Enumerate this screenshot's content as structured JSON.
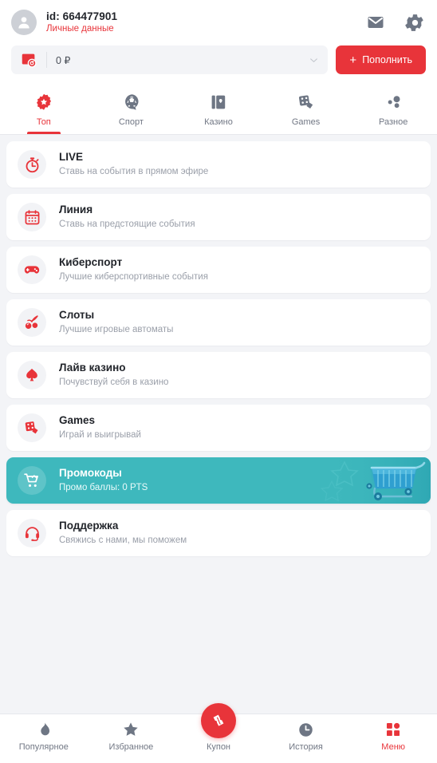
{
  "header": {
    "avatar_icon": "person-icon",
    "user_id": "id: 664477901",
    "personal_data_link": "Личные данные",
    "mail_icon": "mail-icon",
    "settings_icon": "gear-icon"
  },
  "balance": {
    "wallet_icon": "wallet-refresh-icon",
    "amount": "0 ₽",
    "dropdown_icon": "chevron-down-icon",
    "topup_label": "Пополнить",
    "topup_plus": "+",
    "accent_color": "#e8343a"
  },
  "tabs": [
    {
      "label": "Топ",
      "icon": "cog-star-icon",
      "active": true
    },
    {
      "label": "Спорт",
      "icon": "soccer-ball-icon",
      "active": false
    },
    {
      "label": "Казино",
      "icon": "playing-cards-icon",
      "active": false
    },
    {
      "label": "Games",
      "icon": "dice-icon",
      "active": false
    },
    {
      "label": "Разное",
      "icon": "dots-cluster-icon",
      "active": false
    }
  ],
  "menu_items": [
    {
      "title": "LIVE",
      "subtitle": "Ставь на события в прямом эфире",
      "icon": "stopwatch-icon",
      "highlight": false
    },
    {
      "title": "Линия",
      "subtitle": "Ставь на предстоящие события",
      "icon": "calendar-icon",
      "highlight": false
    },
    {
      "title": "Киберспорт",
      "subtitle": "Лучшие киберспортивные события",
      "icon": "gamepad-icon",
      "highlight": false
    },
    {
      "title": "Слоты",
      "subtitle": "Лучшие игровые автоматы",
      "icon": "cherries-icon",
      "highlight": false
    },
    {
      "title": "Лайв казино",
      "subtitle": "Почувствуй себя в казино",
      "icon": "spade-icon",
      "highlight": false
    },
    {
      "title": "Games",
      "subtitle": "Играй и выигрывай",
      "icon": "dice-icon",
      "highlight": false
    },
    {
      "title": "Промокоды",
      "subtitle": "Промо баллы: 0 PTS",
      "icon": "shopping-cart-icon",
      "highlight": true,
      "highlight_color": "#3eb8bd"
    },
    {
      "title": "Поддержка",
      "subtitle": "Свяжись с нами, мы поможем",
      "icon": "headset-icon",
      "highlight": false
    }
  ],
  "bottom_nav": [
    {
      "label": "Популярное",
      "icon": "flame-icon",
      "active": false
    },
    {
      "label": "Избранное",
      "icon": "star-icon",
      "active": false
    },
    {
      "label": "Купон",
      "icon": "ticket-icon",
      "active": false,
      "fab": true
    },
    {
      "label": "История",
      "icon": "clock-icon",
      "active": false
    },
    {
      "label": "Меню",
      "icon": "grid-menu-icon",
      "active": true
    }
  ]
}
